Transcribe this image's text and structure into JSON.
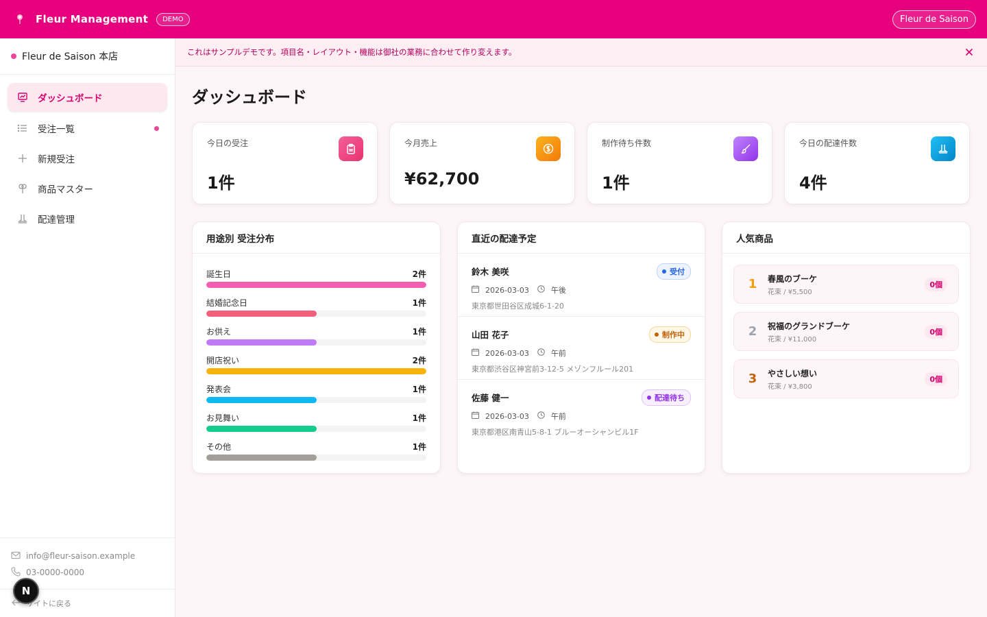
{
  "header": {
    "app_title": "Fleur Management",
    "demo_badge": "DEMO",
    "shop_button": "Fleur de Saison"
  },
  "sidebar": {
    "store_name": "Fleur de Saison 本店",
    "nav": [
      {
        "label": "ダッシュボード",
        "icon": "dashboard-icon",
        "active": true
      },
      {
        "label": "受注一覧",
        "icon": "list-icon",
        "has_dot": true
      },
      {
        "label": "新規受注",
        "icon": "plus-icon"
      },
      {
        "label": "商品マスター",
        "icon": "flower-icon"
      },
      {
        "label": "配達管理",
        "icon": "delivery-icon"
      }
    ],
    "email": "info@fleur-saison.example",
    "phone": "03-0000-0000",
    "back_link": "サイトに戻る",
    "n_badge": "N"
  },
  "notice": {
    "text": "これはサンプルデモです。項目名・レイアウト・機能は御社の業務に合わせて作り変えます。"
  },
  "page": {
    "title": "ダッシュボード"
  },
  "stats": [
    {
      "label": "今日の受注",
      "value": "1件",
      "icon": "clipboard-icon",
      "color": "#ec3f7e"
    },
    {
      "label": "今月売上",
      "value": "¥62,700",
      "icon": "coin-icon",
      "color": "#f59e0b"
    },
    {
      "label": "制作待ち件数",
      "value": "1件",
      "icon": "brush-icon",
      "color": "#a855f7"
    },
    {
      "label": "今日の配達件数",
      "value": "4件",
      "icon": "delivery-icon",
      "color": "#0ea5e9"
    }
  ],
  "distribution": {
    "title": "用途別 受注分布",
    "items": [
      {
        "label": "誕生日",
        "count": "2件",
        "fraction": 1.0,
        "color": "#f45fb0"
      },
      {
        "label": "結婚記念日",
        "count": "1件",
        "fraction": 0.5,
        "color": "#f45f7c"
      },
      {
        "label": "お供え",
        "count": "1件",
        "fraction": 0.5,
        "color": "#c07af5"
      },
      {
        "label": "開店祝い",
        "count": "2件",
        "fraction": 1.0,
        "color": "#f9b208"
      },
      {
        "label": "発表会",
        "count": "1件",
        "fraction": 0.5,
        "color": "#0fb8ef"
      },
      {
        "label": "お見舞い",
        "count": "1件",
        "fraction": 0.5,
        "color": "#14cc8b"
      },
      {
        "label": "その他",
        "count": "1件",
        "fraction": 0.5,
        "color": "#a39e98"
      }
    ]
  },
  "deliveries": {
    "title": "直近の配達予定",
    "items": [
      {
        "name": "鈴木 美咲",
        "date": "2026-03-03",
        "time": "午後",
        "address": "東京都世田谷区成城6-1-20",
        "status": "受付",
        "status_color": "#2563eb",
        "status_bg": "#eef4ff",
        "status_border": "#bcd2fb"
      },
      {
        "name": "山田 花子",
        "date": "2026-03-03",
        "time": "午前",
        "address": "東京都渋谷区神宮前3-12-5 メゾンフルール201",
        "status": "制作中",
        "status_color": "#c2620a",
        "status_bg": "#fff7e8",
        "status_border": "#f7d49a"
      },
      {
        "name": "佐藤 健一",
        "date": "2026-03-03",
        "time": "午前",
        "address": "東京都港区南青山5-8-1 ブルーオーシャンビル1F",
        "status": "配達待ち",
        "status_color": "#9333ea",
        "status_bg": "#f8f0ff",
        "status_border": "#dcc2f7"
      }
    ]
  },
  "popular": {
    "title": "人気商品",
    "items": [
      {
        "rank": "1",
        "name": "春風のブーケ",
        "sub": "花束 / ¥5,500",
        "qty": "0個",
        "rank_color": "#f59e0b"
      },
      {
        "rank": "2",
        "name": "祝福のグランドブーケ",
        "sub": "花束 / ¥11,000",
        "qty": "0個",
        "rank_color": "#9ca3af"
      },
      {
        "rank": "3",
        "name": "やさしい想い",
        "sub": "花束 / ¥3,800",
        "qty": "0個",
        "rank_color": "#c2620a"
      }
    ]
  }
}
